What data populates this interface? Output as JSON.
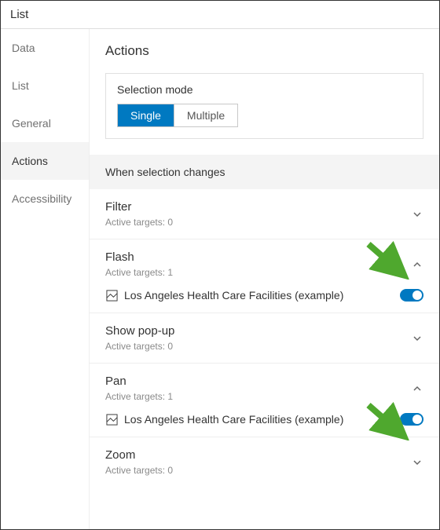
{
  "titlebar": {
    "title": "List"
  },
  "sidebar": {
    "items": [
      {
        "label": "Data"
      },
      {
        "label": "List"
      },
      {
        "label": "General"
      },
      {
        "label": "Actions"
      },
      {
        "label": "Accessibility"
      }
    ],
    "activeIndex": 3
  },
  "main": {
    "page_title": "Actions",
    "selection_mode": {
      "label": "Selection mode",
      "options": [
        {
          "label": "Single",
          "active": true
        },
        {
          "label": "Multiple",
          "active": false
        }
      ]
    },
    "section_header": "When selection changes",
    "actions": [
      {
        "title": "Filter",
        "active_label": "Active targets: 0",
        "expanded": false,
        "targets": []
      },
      {
        "title": "Flash",
        "active_label": "Active targets: 1",
        "expanded": true,
        "targets": [
          {
            "label": "Los Angeles Health Care Facilities (example)",
            "enabled": true
          }
        ]
      },
      {
        "title": "Show pop-up",
        "active_label": "Active targets: 0",
        "expanded": false,
        "targets": []
      },
      {
        "title": "Pan",
        "active_label": "Active targets: 1",
        "expanded": true,
        "targets": [
          {
            "label": "Los Angeles Health Care Facilities (example)",
            "enabled": true
          }
        ]
      },
      {
        "title": "Zoom",
        "active_label": "Active targets: 0",
        "expanded": false,
        "targets": []
      }
    ]
  },
  "annotations": {
    "arrow_color": "#4fa82e"
  }
}
